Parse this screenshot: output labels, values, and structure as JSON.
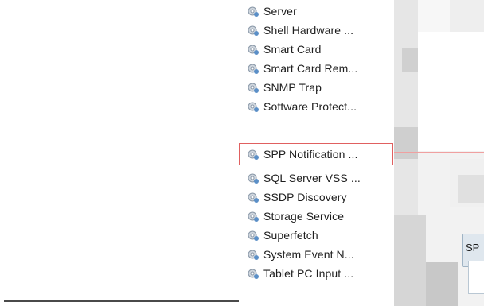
{
  "services": [
    {
      "label": "Server",
      "icon": "service-gear-icon"
    },
    {
      "label": "Shell Hardware ...",
      "icon": "service-gear-icon"
    },
    {
      "label": "Smart Card",
      "icon": "service-gear-icon"
    },
    {
      "label": "Smart Card Rem...",
      "icon": "service-gear-icon"
    },
    {
      "label": "SNMP Trap",
      "icon": "service-gear-icon"
    },
    {
      "label": "Software Protect...",
      "icon": "service-gear-icon"
    },
    {
      "label": "SPP Notification ...",
      "icon": "service-gear-icon",
      "selected": true
    },
    {
      "label": "SQL Server VSS ...",
      "icon": "service-gear-icon"
    },
    {
      "label": "SSDP Discovery",
      "icon": "service-gear-icon"
    },
    {
      "label": "Storage Service",
      "icon": "service-gear-icon"
    },
    {
      "label": "Superfetch",
      "icon": "service-gear-icon"
    },
    {
      "label": "System Event N...",
      "icon": "service-gear-icon"
    },
    {
      "label": "Tablet PC Input ...",
      "icon": "service-gear-icon"
    }
  ],
  "dialog": {
    "title_fragment": "SP"
  },
  "colors": {
    "selection_outline": "#e06060",
    "icon_blue": "#5b8fc7"
  }
}
